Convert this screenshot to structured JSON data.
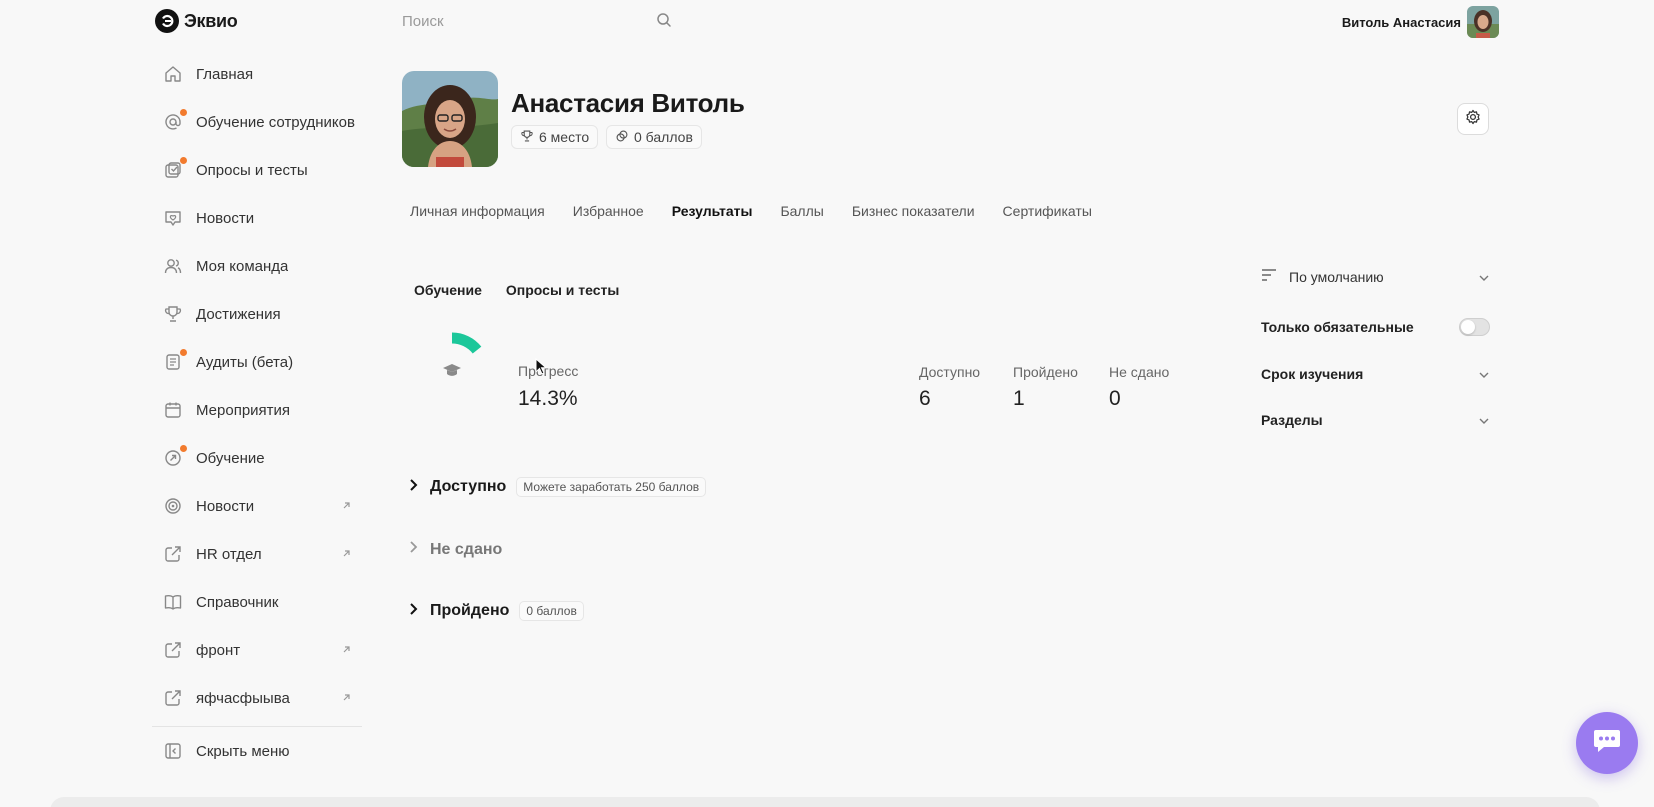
{
  "header": {
    "logo_text": "Эквио",
    "search_placeholder": "Поиск",
    "user_name": "Витоль Анастасия"
  },
  "sidebar": {
    "items": [
      {
        "label": "Главная",
        "icon": "home-icon",
        "dot": false,
        "external": false
      },
      {
        "label": "Обучение сотрудников",
        "icon": "at-icon",
        "dot": true,
        "external": false
      },
      {
        "label": "Опросы и тесты",
        "icon": "survey-icon",
        "dot": true,
        "external": false
      },
      {
        "label": "Новости",
        "icon": "news-icon",
        "dot": false,
        "external": false
      },
      {
        "label": "Моя команда",
        "icon": "team-icon",
        "dot": false,
        "external": false
      },
      {
        "label": "Достижения",
        "icon": "trophy-icon",
        "dot": false,
        "external": false
      },
      {
        "label": "Аудиты (бета)",
        "icon": "audit-icon",
        "dot": true,
        "external": false
      },
      {
        "label": "Мероприятия",
        "icon": "calendar-icon",
        "dot": false,
        "external": false
      },
      {
        "label": "Обучение",
        "icon": "learning-icon",
        "dot": true,
        "external": false
      },
      {
        "label": "Новости",
        "icon": "target-icon",
        "dot": false,
        "external": true
      },
      {
        "label": "HR отдел",
        "icon": "external-link-icon",
        "dot": false,
        "external": true
      },
      {
        "label": "Справочник",
        "icon": "book-icon",
        "dot": false,
        "external": false
      },
      {
        "label": "фронт",
        "icon": "external-link-icon",
        "dot": false,
        "external": true
      },
      {
        "label": "яфчасфыыва",
        "icon": "external-link-icon",
        "dot": false,
        "external": true
      }
    ],
    "hide_menu_label": "Скрыть меню"
  },
  "profile": {
    "name": "Анастасия Витоль",
    "place": "6 место",
    "points": "0 баллов"
  },
  "tabs": [
    {
      "label": "Личная информация",
      "active": false
    },
    {
      "label": "Избранное",
      "active": false
    },
    {
      "label": "Результаты",
      "active": true
    },
    {
      "label": "Баллы",
      "active": false
    },
    {
      "label": "Бизнес показатели",
      "active": false
    },
    {
      "label": "Сертификаты",
      "active": false
    }
  ],
  "subtabs": [
    "Обучение",
    "Опросы и тесты"
  ],
  "progress": {
    "label": "Прогресс",
    "value": "14.3%",
    "fraction": 0.143,
    "color": "#1cc79a"
  },
  "stats": [
    {
      "label": "Доступно",
      "value": "6"
    },
    {
      "label": "Пройдено",
      "value": "1"
    },
    {
      "label": "Не сдано",
      "value": "0"
    }
  ],
  "sections": [
    {
      "title": "Доступно",
      "badge": "Можете заработать 250 баллов",
      "muted": false
    },
    {
      "title": "Не сдано",
      "badge": "",
      "muted": true
    },
    {
      "title": "Пройдено",
      "badge": "0 баллов",
      "muted": false
    }
  ],
  "filters": {
    "sort_value": "По умолчанию",
    "only_required_label": "Только обязательные",
    "only_required_on": false,
    "study_period_label": "Срок изучения",
    "sections_label": "Разделы"
  },
  "colors": {
    "accent_dot": "#f27b2e",
    "chat": "#9a7bf0",
    "progress": "#1cc79a"
  }
}
